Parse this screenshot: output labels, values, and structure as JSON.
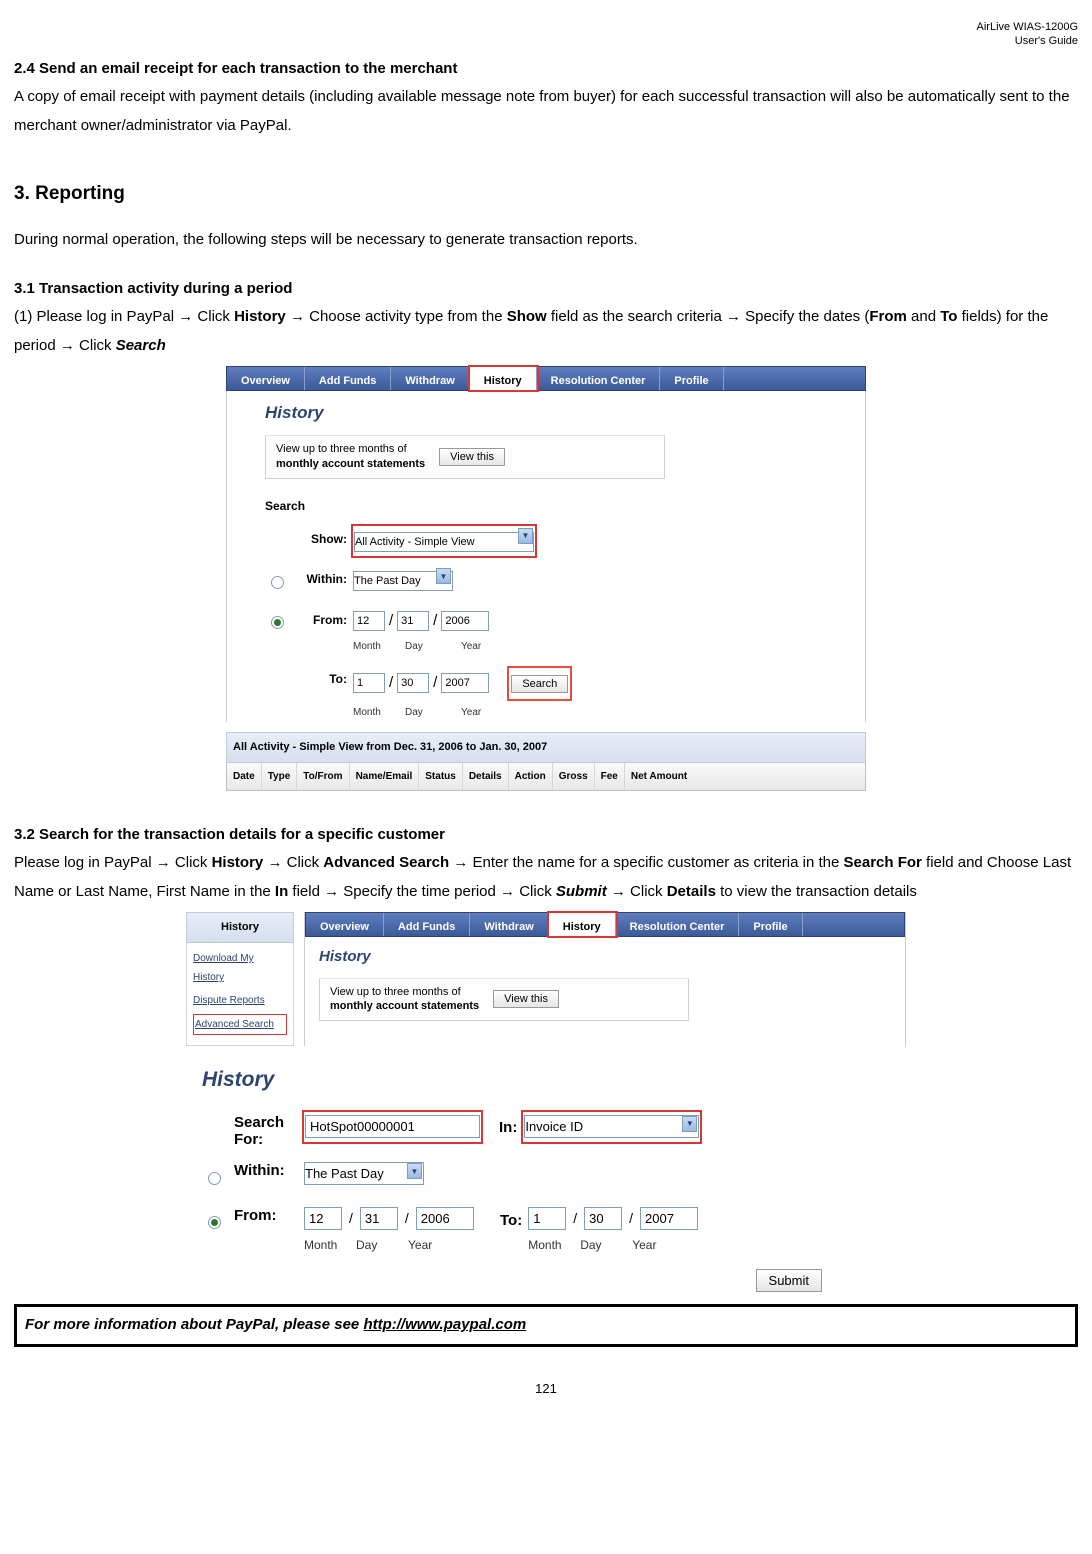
{
  "meta": {
    "product": "AirLive WIAS-1200G",
    "doctype": "User's Guide",
    "page": "121"
  },
  "s24": {
    "title": "2.4 Send an email receipt for each transaction to the merchant",
    "para": "A copy of email receipt with payment details (including available message note from buyer) for each successful transaction will also be automatically sent to the merchant owner/administrator via PayPal."
  },
  "s3": {
    "title": "3.  Reporting",
    "intro": "During normal operation, the following steps will be necessary to generate transaction reports."
  },
  "s31": {
    "title": "3.1 Transaction activity during a period",
    "line_a": "(1) Please log in PayPal → Click ",
    "history": "History",
    "line_b": " → Choose activity type from the ",
    "show": "Show",
    "line_c": " field as the search criteria → Specify the dates (",
    "from": "From",
    "and": " and ",
    "to": "To",
    "line_d": " fields) for the period → Click ",
    "search": "Search"
  },
  "fig1": {
    "tabs": [
      "Overview",
      "Add Funds",
      "Withdraw",
      "History",
      "Resolution Center",
      "Profile"
    ],
    "hist_heading": "History",
    "stmt_l1": "View up to three months of",
    "stmt_l2": "monthly account statements",
    "viewthis": "View this",
    "search_label": "Search",
    "show_label": "Show:",
    "show_select": "All Activity - Simple View",
    "within_label": "Within:",
    "within_select": "The Past Day",
    "from_label": "From:",
    "to_label": "To:",
    "from": {
      "m": "12",
      "d": "31",
      "y": "2006"
    },
    "to": {
      "m": "1",
      "d": "30",
      "y": "2007"
    },
    "dtl_m": "Month",
    "dtl_d": "Day",
    "dtl_y": "Year",
    "search_btn": "Search",
    "activity_bar": "All Activity - Simple View from Dec. 31, 2006 to Jan. 30, 2007",
    "cols": [
      "Date",
      "Type",
      "To/From",
      "Name/Email",
      "Status",
      "Details",
      "Action",
      "Gross",
      "Fee",
      "Net Amount"
    ]
  },
  "s32": {
    "title": "3.2 Search for the transaction details for a specific customer",
    "t1": "Please log in PayPal → Click ",
    "history": "History",
    "t2": " → Click ",
    "advsearch": "Advanced Search",
    "t3": " → Enter the name for a specific customer as criteria in the ",
    "searchfor": "Search For",
    "t4": " field and Choose Last Name or Last Name, First Name in the ",
    "inlbl": "In",
    "t5": " field → Specify the time period → Click ",
    "submit": "Submit",
    "t6": " → Click ",
    "details": "Details",
    "t7": " to view the transaction details"
  },
  "fig2": {
    "tabs": [
      "Overview",
      "Add Funds",
      "Withdraw",
      "History",
      "Resolution Center",
      "Profile"
    ],
    "side_head": "History",
    "side_links": [
      "Download My History",
      "Dispute Reports",
      "Advanced Search"
    ],
    "hist_heading": "History",
    "stmt_l1": "View up to three months of",
    "stmt_l2": "monthly account statements",
    "viewthis": "View this",
    "hist_title2": "History",
    "searchfor_label": "Search For:",
    "searchfor_val": "HotSpot00000001",
    "in_label": "In:",
    "in_select": "Invoice ID",
    "within_label": "Within:",
    "within_select": "The Past Day",
    "from_label": "From:",
    "to_label": "To:",
    "from": {
      "m": "12",
      "d": "31",
      "y": "2006"
    },
    "to": {
      "m": "1",
      "d": "30",
      "y": "2007"
    },
    "dtl_m": "Month",
    "dtl_d": "Day",
    "dtl_y": "Year",
    "submit": "Submit"
  },
  "footer": {
    "text_a": "For more information about PayPal, please see ",
    "url": "http://www.paypal.com"
  }
}
